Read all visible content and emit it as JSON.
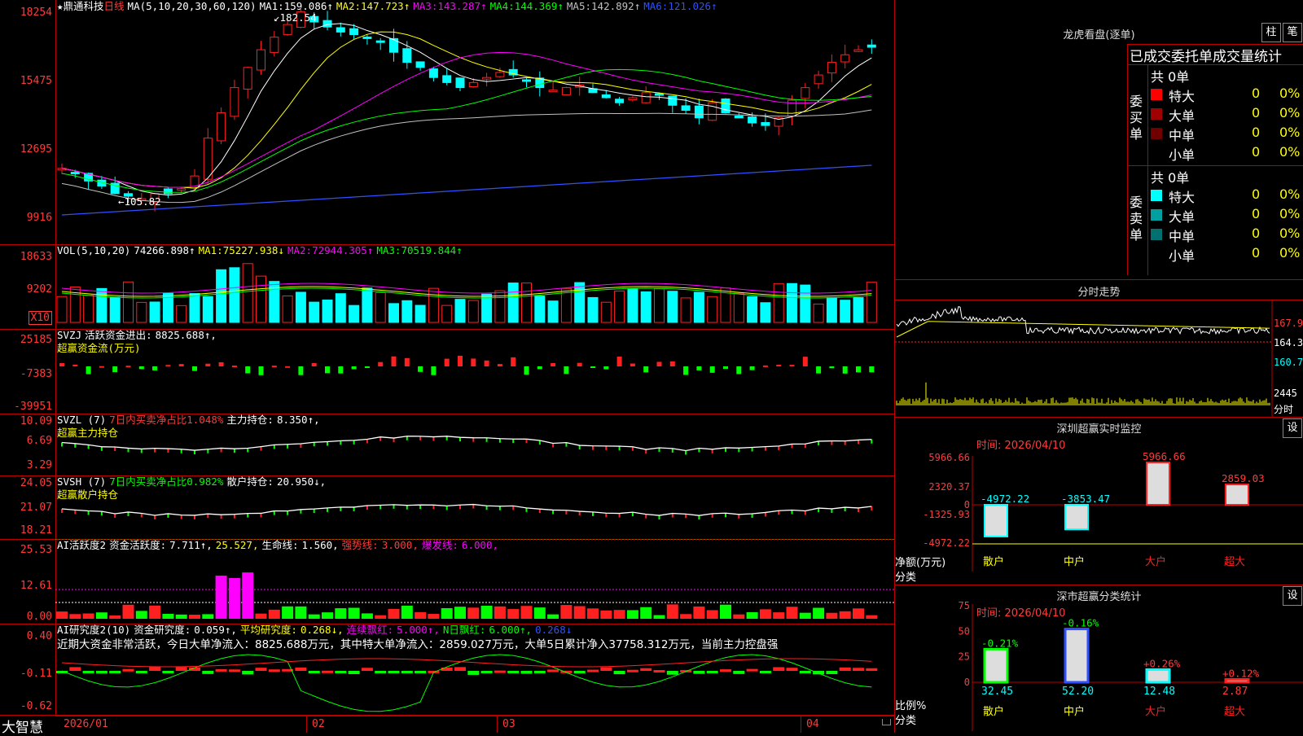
{
  "main": {
    "stock_name": "★鼎通科技",
    "period": "日线",
    "ma_header": "MA(5,10,20,30,60,120)",
    "ma_values": [
      {
        "label": "MA1:",
        "value": "159.086↑",
        "color": "#ffffff"
      },
      {
        "label": "MA2:",
        "value": "147.723↑",
        "color": "#ffff00"
      },
      {
        "label": "MA3:",
        "value": "143.287↑",
        "color": "#ff00ff"
      },
      {
        "label": "MA4:",
        "value": "144.369↑",
        "color": "#00ff00"
      },
      {
        "label": "MA5:",
        "value": "142.892↑",
        "color": "#c0c0c0"
      },
      {
        "label": "MA6:",
        "value": "121.026↑",
        "color": "#3050ff"
      }
    ],
    "y_ticks": [
      "18254",
      "15475",
      "12695",
      "9916"
    ],
    "high_label": "182.54",
    "low_label": "105.82"
  },
  "vol": {
    "header": "VOL(5,10,20)",
    "value": "74266.898↑",
    "ma": [
      {
        "label": "MA1:",
        "value": "75227.938↓",
        "color": "#ffff00"
      },
      {
        "label": "MA2:",
        "value": "72944.305↑",
        "color": "#ff00ff"
      },
      {
        "label": "MA3:",
        "value": "70519.844↑",
        "color": "#00ff00"
      }
    ],
    "y_ticks": [
      "18633",
      "9202"
    ],
    "unit": "X10"
  },
  "svzj": {
    "header": "SVZJ",
    "label": "活跃资金进出:",
    "value": "8825.688↑,",
    "subtitle": "超赢资金流(万元)",
    "y_ticks": [
      "25185",
      "-7383",
      "-39951"
    ]
  },
  "svzl": {
    "header": "SVZL (7)",
    "label1": "7日内买卖净占比1.048%",
    "label2": "主力持仓:",
    "value2": "8.350↑,",
    "subtitle": "超赢主力持仓",
    "y_ticks": [
      "10.09",
      "6.69",
      "3.29"
    ]
  },
  "svsh": {
    "header": "SVSH (7)",
    "label1": "7日内买卖净占比0.982%",
    "label2": "散户持仓:",
    "value2": "20.950↓,",
    "subtitle": "超赢散户持仓",
    "y_ticks": [
      "24.05",
      "21.07",
      "18.21"
    ]
  },
  "ai_active": {
    "header": "AI活跃度2",
    "label1": "资金活跃度:",
    "value1": "7.711↑,",
    "value2": "25.527,",
    "label3": "生命线:",
    "value3": "1.560,",
    "label4": "强势线:",
    "value4": "3.000,",
    "label5": "爆发线:",
    "value5": "6.000,",
    "y_ticks": [
      "25.53",
      "12.61",
      "0.00"
    ]
  },
  "ai_research": {
    "header": "AI研究度2(10)",
    "label1": "资金研究度:",
    "value1": "0.059↑,",
    "label2": "平均研究度:",
    "value2": "0.268↓,",
    "label3": "连续飘红:",
    "value3": "5.000↑,",
    "label4": "N日飘红:",
    "value4": "6.000↑,",
    "value5": "0.268↓",
    "comment": "近期大资金非常活跃，今日大单净流入：8825.688万元，其中特大单净流入：2859.027万元，大单5日累计净入37758.312万元，当前主力控盘强",
    "y_ticks": [
      "0.40",
      "-0.11",
      "-0.62"
    ]
  },
  "bottom": {
    "brand": "大智慧",
    "dates": [
      "2026/01",
      "02",
      "03",
      "04"
    ]
  },
  "longhu": {
    "title": "龙虎看盘(逐单)",
    "btn1": "柱",
    "btn2": "笔",
    "tabs": "已成交委托单成交量统计",
    "buy_label": "委买单",
    "sell_label": "委卖单",
    "buy_total": "共 0单",
    "sell_total": "共 0单",
    "buy_rows": [
      {
        "name": "特大",
        "count": "0",
        "pct": "0%",
        "color": "#ff0000"
      },
      {
        "name": "大单",
        "count": "0",
        "pct": "0%",
        "color": "#a00000"
      },
      {
        "name": "中单",
        "count": "0",
        "pct": "0%",
        "color": "#700000"
      },
      {
        "name": "小单",
        "count": "0",
        "pct": "0%",
        "color": "#000000"
      }
    ],
    "sell_rows": [
      {
        "name": "特大",
        "count": "0",
        "pct": "0%",
        "color": "#00ffff"
      },
      {
        "name": "大单",
        "count": "0",
        "pct": "0%",
        "color": "#00a0a0"
      },
      {
        "name": "中单",
        "count": "0",
        "pct": "0%",
        "color": "#007070"
      },
      {
        "name": "小单",
        "count": "0",
        "pct": "0%",
        "color": "#000000"
      }
    ]
  },
  "intraday": {
    "title": "分时走势",
    "y_ticks": [
      "167.9",
      "164.3",
      "160.7",
      "2445"
    ],
    "unit": "分时"
  },
  "sz_monitor": {
    "title": "深圳超赢实时监控",
    "btn": "设",
    "time": "时间: 2026/04/10",
    "y_ticks": [
      "5966.66",
      "2320.37",
      "0",
      "-1325.93",
      "-4972.22"
    ],
    "ylabel1": "净额(万元)",
    "ylabel2": "分类",
    "categories": [
      "散户",
      "中户",
      "大户",
      "超大"
    ],
    "values": [
      -4972.22,
      -3853.47,
      5966.66,
      2859.03
    ],
    "value_labels": [
      "-4972.22",
      "-3853.47",
      "5966.66",
      "2859.03"
    ]
  },
  "sz_class": {
    "title": "深市超赢分类统计",
    "btn": "设",
    "time": "时间: 2026/04/10",
    "y_ticks": [
      "75",
      "50",
      "25",
      "0"
    ],
    "ylabel1": "比例%",
    "ylabel2": "分类",
    "categories": [
      "散户",
      "中户",
      "大户",
      "超大"
    ],
    "values": [
      32.45,
      52.2,
      12.48,
      2.87
    ],
    "value_labels": [
      "32.45",
      "52.20",
      "12.48",
      "2.87"
    ],
    "changes": [
      "-0.21%",
      "-0.16%",
      "+0.26%",
      "+0.12%"
    ]
  }
}
